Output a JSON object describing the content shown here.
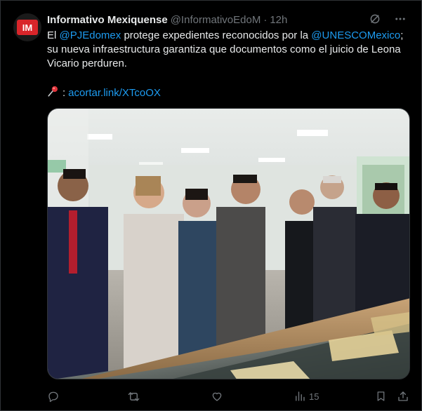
{
  "author": {
    "display_name": "Informativo Mexiquense",
    "handle": "@InformativoEdoM",
    "separator": "·",
    "time": "12h",
    "avatar_text": "IM"
  },
  "tweet": {
    "text_1": "El ",
    "mention_1": "@PJEdomex",
    "text_2": " protege expedientes reconocidos por la ",
    "mention_2": "@UNESCOMexico",
    "text_3": "; su nueva infraestructura garantiza que documentos como el juicio de Leona Vicario perduren.",
    "link_prefix": ":",
    "link": "acortar.link/XTcoOX"
  },
  "stats": {
    "views": "15"
  },
  "icons": {
    "grok": "grok-icon",
    "more": "more-icon",
    "reply": "reply-icon",
    "repost": "repost-icon",
    "like": "heart-icon",
    "views": "views-icon",
    "bookmark": "bookmark-icon",
    "share": "share-icon",
    "pin": "pushpin-icon"
  },
  "colors": {
    "background": "#000000",
    "text": "#e7e9ea",
    "muted": "#71767b",
    "link": "#1d9bf0",
    "brand_red": "#d9252a"
  }
}
